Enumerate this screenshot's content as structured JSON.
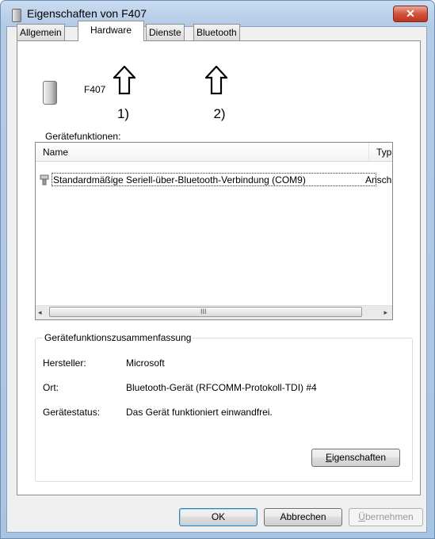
{
  "window": {
    "title": "Eigenschaften von F407",
    "close_glyph": "✕"
  },
  "tabs": [
    {
      "label": "Allgemein",
      "active": false
    },
    {
      "label": "Hardware",
      "active": true
    },
    {
      "label": "Dienste",
      "active": false
    },
    {
      "label": "Bluetooth",
      "active": false
    }
  ],
  "device": {
    "name": "F407",
    "icon": "printer-device-icon"
  },
  "callouts": [
    {
      "label": "1)",
      "icon": "arrow-up-icon"
    },
    {
      "label": "2)",
      "icon": "arrow-up-icon"
    }
  ],
  "functions": {
    "label": "Gerätefunktionen:",
    "columns": [
      "Name",
      "Typ"
    ],
    "rows": [
      {
        "name": "Standardmäßige Seriell-über-Bluetooth-Verbindung (COM9)",
        "type": "Anschlü",
        "icon": "port-icon"
      }
    ],
    "scroll_left": "◂",
    "scroll_right": "▸",
    "scroll_grip": "III"
  },
  "summary": {
    "title": "Gerätefunktionszusammenfassung",
    "manufacturer_label": "Hersteller:",
    "manufacturer_value": "Microsoft",
    "location_label": "Ort:",
    "location_value": "Bluetooth-Gerät (RFCOMM-Protokoll-TDI) #4",
    "status_label": "Gerätestatus:",
    "status_value": "Das Gerät funktioniert einwandfrei.",
    "properties_button": {
      "mnemonic": "E",
      "rest": "igenschaften"
    }
  },
  "footer": {
    "ok_label": "OK",
    "cancel_label": "Abbrechen",
    "apply_mnemonic": "Ü",
    "apply_rest": "bernehmen"
  },
  "colors": {
    "titlebar": "#b4cbe6",
    "close_button": "#c0341e",
    "default_button_border": "#3c7fb1"
  }
}
